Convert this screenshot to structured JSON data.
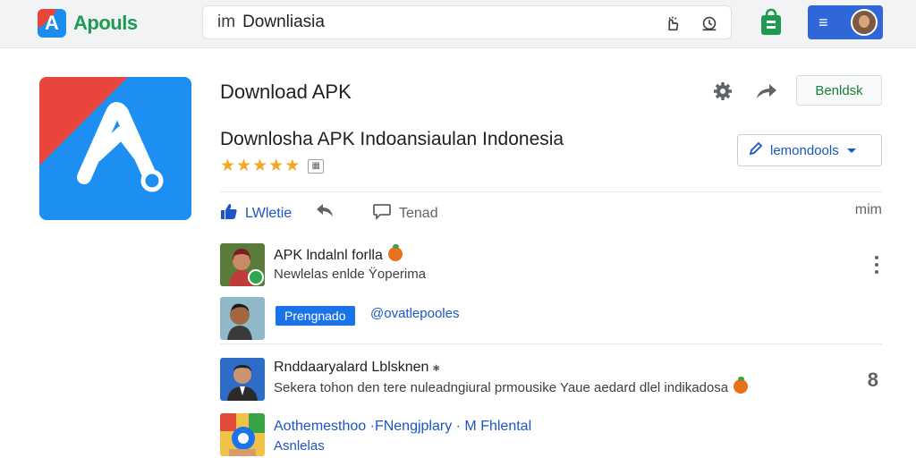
{
  "header": {
    "brand": "Apouls",
    "brand_glyph": "A",
    "search_prefix": "im",
    "search_value": "Downliasia",
    "menu_glyph": "≡"
  },
  "app": {
    "title": "Download APK",
    "subtitle": "Downlosha APK Indoansiaulan Indonesia",
    "rating_stars": 5,
    "install_label": "Benldsk",
    "dropdown_label": "lemondools"
  },
  "actions": {
    "like": "LWletie",
    "comment": "Tenad",
    "more": "mim"
  },
  "items": [
    {
      "title": "APK lndalnl forlla",
      "subtitle": "Newlelas enlde Ÿoperima"
    },
    {
      "badge": "Prengnado",
      "handle": "@ovatlepooles"
    },
    {
      "title": "Rnddaaryalard Lblsknen",
      "subtitle": "Sekera tohon den tere nuleadngiural prmousike Yaue aedard dlel indikadosa",
      "count": "8"
    },
    {
      "title": "Aothemesthoo ·FNengjplary · M Fhlental",
      "subtitle": "Asnlelas"
    }
  ],
  "colors": {
    "accent_blue": "#1a73e8",
    "brand_green": "#1e9b50",
    "star": "#f5a623",
    "logo_red": "#e8453c",
    "logo_blue": "#1d8ff2"
  }
}
